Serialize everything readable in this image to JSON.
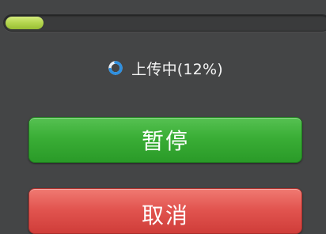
{
  "upload": {
    "progress_fraction": 0.12,
    "status_text": "上传中(12%)",
    "spinner_icon": "loading-spinner-icon"
  },
  "buttons": {
    "pause_label": "暂停",
    "cancel_label": "取消"
  },
  "colors": {
    "background": "#444546",
    "progress_fill": "#b3d54e",
    "pause_button": "#3aae36",
    "cancel_button": "#e25550",
    "spinner_blue": "#2d8fe0"
  }
}
